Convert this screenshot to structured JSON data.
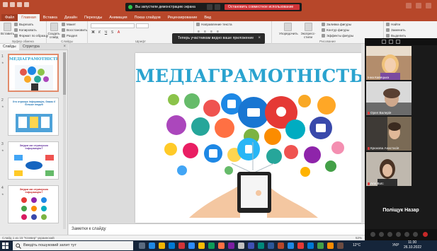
{
  "share_banner": {
    "message": "Вы запустили демонстрацию экрана",
    "stop_label": "Остановить совместное использование"
  },
  "ribbon_tabs": [
    "Файл",
    "Главная",
    "Вставка",
    "Дизайн",
    "Переходы",
    "Анимация",
    "Показ слайдов",
    "Рецензирование",
    "Вид"
  ],
  "ribbon": {
    "paste": "Вставить",
    "cut": "Вырезать",
    "copy": "Копировать",
    "format_painter": "Формат по образцу",
    "clipboard_group": "Буфер обмена",
    "new_slide": "Создать слайд",
    "layout": "Макет",
    "reset": "Восстановить",
    "section": "Раздел",
    "slides_group": "Слайды",
    "font_group": "Шрифт",
    "text_direction": "Направление текста",
    "paragraph_group": "Абзац",
    "arrange": "Упорядочить",
    "quick_styles": "Экспресс-стили",
    "shape_fill": "Заливка фигуры",
    "shape_outline": "Контур фигуры",
    "shape_effects": "Эффекты фигуры",
    "drawing_group": "Рисование",
    "find": "Найти",
    "replace": "Заменить",
    "select": "Выделить",
    "editing_group": "Редактирование"
  },
  "toast": {
    "message": "Теперь участникам видно ваше приложение",
    "close": "×"
  },
  "slide_pane": {
    "tab_slides": "Слайды",
    "tab_outline": "Структура",
    "close": "×",
    "thumbnails": [
      {
        "num": "1",
        "title": "МЕДІАГРАМОТНІСТЬ"
      },
      {
        "num": "2",
        "title": "Хто отримує інформацію, бажає її більше людей"
      },
      {
        "num": "3",
        "title": "Звідки ми отримуємо інформацію?"
      },
      {
        "num": "4",
        "title": "Звідки ми отримуємо інформацію?"
      }
    ]
  },
  "slide": {
    "title": "МЕДІАГРАМОТНІСТЬ"
  },
  "notes": {
    "placeholder": "Заметки к слайду"
  },
  "status_bar": {
    "left": "Слайд 1 из 15   \"Клевер\"   украинский",
    "right": "52%"
  },
  "participants": {
    "list": [
      {
        "name": "Інна Кавецька"
      },
      {
        "name": "Орел Валерія"
      },
      {
        "name": "Крюкова Анастасія"
      },
      {
        "name": "Ann Butc"
      }
    ],
    "speaker": "Поліщук Назар"
  },
  "taskbar": {
    "search_placeholder": "Введіть пошуковий запит тут",
    "weather": "12°C",
    "language": "УКР",
    "time": "11:30",
    "date": "26.10.2022"
  },
  "colors": {
    "brand": "#b7472a",
    "slide_title": "#2aa3cf",
    "stop_share": "#d13438",
    "taskbar": "#15253a"
  }
}
